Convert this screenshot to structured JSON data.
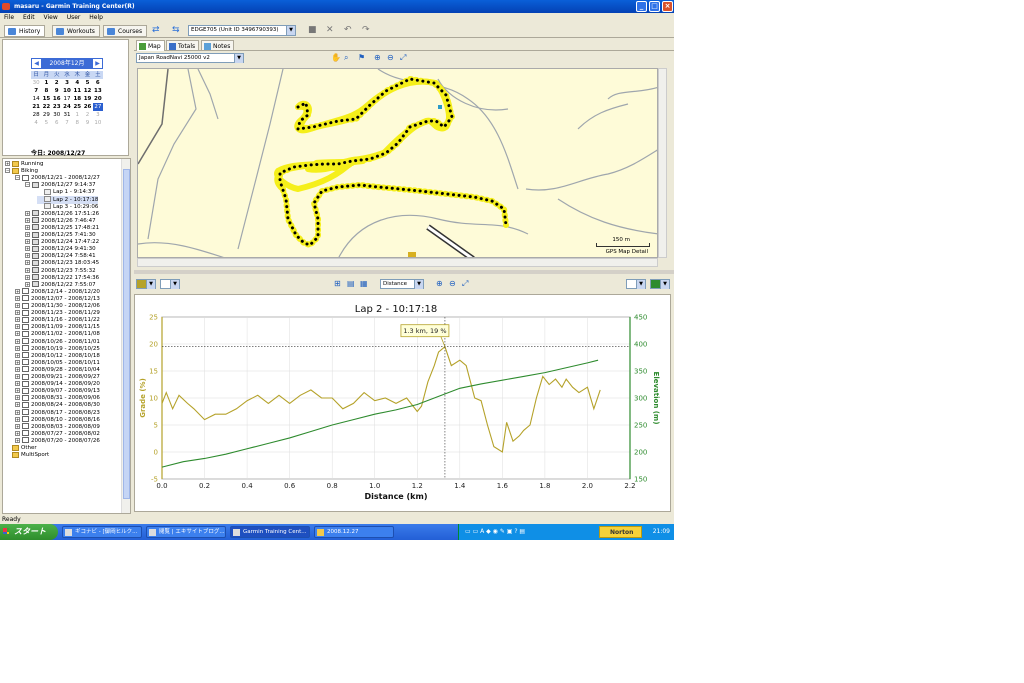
{
  "window": {
    "title": "masaru - Garmin Training Center(R)"
  },
  "menu": [
    "File",
    "Edit",
    "View",
    "User",
    "Help"
  ],
  "left_tabs": [
    "History",
    "Workouts",
    "Courses"
  ],
  "device": {
    "selected": "EDGE705 (Unit ID 3496790393)"
  },
  "calendar": {
    "month_label": "2008年12月",
    "weekdays": [
      "日",
      "月",
      "火",
      "水",
      "木",
      "金",
      "土"
    ],
    "weeks": [
      [
        "30",
        "1",
        "2",
        "3",
        "4",
        "5",
        "6"
      ],
      [
        "7",
        "8",
        "9",
        "10",
        "11",
        "12",
        "13"
      ],
      [
        "14",
        "15",
        "16",
        "17",
        "18",
        "19",
        "20"
      ],
      [
        "21",
        "22",
        "23",
        "24",
        "25",
        "26",
        "27"
      ],
      [
        "28",
        "29",
        "30",
        "31",
        "1",
        "2",
        "3"
      ],
      [
        "4",
        "5",
        "6",
        "7",
        "8",
        "9",
        "10"
      ]
    ],
    "today_label": "今日: 2008/12/27"
  },
  "tree": {
    "running": "Running",
    "biking": "Biking",
    "week_current": "2008/12/21 - 2008/12/27",
    "activity_current": "2008/12/27 9:14:37",
    "laps": [
      "Lap 1 - 9:14:37",
      "Lap 2 - 10:17:18",
      "Lap 3 - 10:29:06"
    ],
    "activities": [
      "2008/12/26 17:51:26",
      "2008/12/26 7:46:47",
      "2008/12/25 17:48:21",
      "2008/12/25 7:41:30",
      "2008/12/24 17:47:22",
      "2008/12/24 9:41:30",
      "2008/12/24 7:58:41",
      "2008/12/23 18:03:45",
      "2008/12/23 7:55:32",
      "2008/12/22 17:54:36",
      "2008/12/22 7:55:07"
    ],
    "weeks": [
      "2008/12/14 - 2008/12/20",
      "2008/12/07 - 2008/12/13",
      "2008/11/30 - 2008/12/06",
      "2008/11/23 - 2008/11/29",
      "2008/11/16 - 2008/11/22",
      "2008/11/09 - 2008/11/15",
      "2008/11/02 - 2008/11/08",
      "2008/10/26 - 2008/11/01",
      "2008/10/19 - 2008/10/25",
      "2008/10/12 - 2008/10/18",
      "2008/10/05 - 2008/10/11",
      "2008/09/28 - 2008/10/04",
      "2008/09/21 - 2008/09/27",
      "2008/09/14 - 2008/09/20",
      "2008/09/07 - 2008/09/13",
      "2008/08/31 - 2008/09/06",
      "2008/08/24 - 2008/08/30",
      "2008/08/17 - 2008/08/23",
      "2008/08/10 - 2008/08/16",
      "2008/08/03 - 2008/08/09",
      "2008/07/27 - 2008/08/02",
      "2008/07/20 - 2008/07/26"
    ],
    "other": "Other",
    "multisport": "MultiSport"
  },
  "map": {
    "tabs": [
      "Map",
      "Totals",
      "Notes"
    ],
    "map_select": "Japan RoadNavi 25000 v2",
    "scale_label": "150 m",
    "detail_label": "GPS Map Detail"
  },
  "chart_toolbar": {
    "axis_select": "Distance"
  },
  "status": "Ready",
  "taskbar": {
    "start": "スタート",
    "tasks": [
      "ギコナビ - [御岡ヒルク...",
      "閲覧 | エキサイトブログ...",
      "Garmin Training Cent...",
      "2008.12.27"
    ],
    "norton": "Norton",
    "clock": "21:09"
  },
  "colors": {
    "grade": "#b5a22a",
    "elevation": "#2e8b2e",
    "track": "#f5ef1a",
    "track_dots": "#000000",
    "map_bg": "#fefbd8",
    "road": "#9fa6ad"
  },
  "chart_data": {
    "type": "line",
    "title": "Lap 2 - 10:17:18",
    "xlabel": "Distance (km)",
    "ylabel": "Grade (%)",
    "y2label": "Elevation (m)",
    "xlim": [
      0.0,
      2.2
    ],
    "ylim": [
      -5,
      25
    ],
    "y2lim": [
      150,
      450
    ],
    "x_ticks": [
      "0.0",
      "0.2",
      "0.4",
      "0.6",
      "0.8",
      "1.0",
      "1.2",
      "1.4",
      "1.6",
      "1.8",
      "2.0",
      "2.2"
    ],
    "y_ticks": [
      "-5",
      "0",
      "5",
      "10",
      "15",
      "20",
      "25"
    ],
    "y2_ticks": [
      "150",
      "200",
      "250",
      "300",
      "350",
      "400",
      "450"
    ],
    "annotation": {
      "text": "1.3 km, 19 %",
      "x": 1.33,
      "y": 19.5
    },
    "series": [
      {
        "name": "Grade",
        "axis": "left",
        "points": [
          [
            0.0,
            9
          ],
          [
            0.02,
            11
          ],
          [
            0.05,
            8
          ],
          [
            0.08,
            10.5
          ],
          [
            0.12,
            9
          ],
          [
            0.15,
            8
          ],
          [
            0.2,
            6
          ],
          [
            0.25,
            7
          ],
          [
            0.3,
            7
          ],
          [
            0.35,
            8
          ],
          [
            0.4,
            9.5
          ],
          [
            0.45,
            10.5
          ],
          [
            0.5,
            9
          ],
          [
            0.55,
            10.5
          ],
          [
            0.6,
            9
          ],
          [
            0.65,
            10.5
          ],
          [
            0.7,
            11.5
          ],
          [
            0.75,
            10
          ],
          [
            0.8,
            10
          ],
          [
            0.85,
            8
          ],
          [
            0.9,
            9
          ],
          [
            0.95,
            11
          ],
          [
            1.0,
            9.5
          ],
          [
            1.05,
            10
          ],
          [
            1.1,
            9
          ],
          [
            1.15,
            10
          ],
          [
            1.2,
            7.5
          ],
          [
            1.22,
            8.5
          ],
          [
            1.25,
            13
          ],
          [
            1.28,
            16
          ],
          [
            1.3,
            18.5
          ],
          [
            1.33,
            19.5
          ],
          [
            1.36,
            16
          ],
          [
            1.4,
            17
          ],
          [
            1.43,
            16
          ],
          [
            1.47,
            10
          ],
          [
            1.5,
            9.5
          ],
          [
            1.53,
            5
          ],
          [
            1.56,
            1
          ],
          [
            1.6,
            0
          ],
          [
            1.62,
            5.5
          ],
          [
            1.65,
            2
          ],
          [
            1.68,
            3
          ],
          [
            1.7,
            4
          ],
          [
            1.73,
            5
          ],
          [
            1.76,
            10
          ],
          [
            1.79,
            14
          ],
          [
            1.82,
            12.5
          ],
          [
            1.85,
            13.5
          ],
          [
            1.88,
            12
          ],
          [
            1.9,
            13.5
          ],
          [
            1.93,
            12
          ],
          [
            1.96,
            11
          ],
          [
            2.0,
            12
          ],
          [
            2.03,
            8
          ],
          [
            2.06,
            11.5
          ]
        ]
      },
      {
        "name": "Elevation",
        "axis": "right",
        "points": [
          [
            0.0,
            172
          ],
          [
            0.1,
            182
          ],
          [
            0.2,
            188
          ],
          [
            0.3,
            196
          ],
          [
            0.4,
            206
          ],
          [
            0.5,
            216
          ],
          [
            0.6,
            226
          ],
          [
            0.7,
            238
          ],
          [
            0.8,
            250
          ],
          [
            0.9,
            260
          ],
          [
            1.0,
            270
          ],
          [
            1.1,
            278
          ],
          [
            1.2,
            288
          ],
          [
            1.3,
            303
          ],
          [
            1.4,
            318
          ],
          [
            1.5,
            326
          ],
          [
            1.6,
            333
          ],
          [
            1.7,
            340
          ],
          [
            1.8,
            347
          ],
          [
            1.9,
            356
          ],
          [
            2.0,
            365
          ],
          [
            2.05,
            370
          ]
        ]
      }
    ]
  }
}
